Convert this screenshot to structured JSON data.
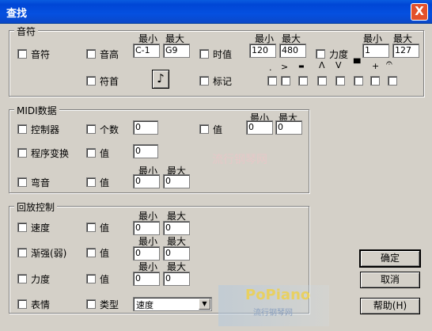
{
  "window": {
    "title": "查找",
    "close_label": "X"
  },
  "note": {
    "legend": "音符",
    "min_label": "最小",
    "max_label": "最大",
    "note_label": "音符",
    "pitch_label": "音高",
    "pitch_min": "C-1",
    "pitch_max": "G9",
    "duration_label": "时值",
    "duration_min": "120",
    "duration_max": "480",
    "velocity_label": "力度",
    "velocity_min": "1",
    "velocity_max": "127",
    "notehead_label": "符首",
    "marks_label": "标记",
    "mark_symbols": [
      ".",
      ">",
      "▬",
      "Λ",
      "V",
      "▀",
      "+",
      "𝄐"
    ]
  },
  "midi": {
    "legend": "MIDI数据",
    "min_label": "最小",
    "max_label": "最大",
    "controller_label": "控制器",
    "count_label": "个数",
    "count_value": "0",
    "value_label": "值",
    "value_min": "0",
    "value_max": "0",
    "program_label": "程序变换",
    "program_value_label": "值",
    "program_value": "0",
    "bend_label": "弯音",
    "bend_value_label": "值",
    "bend_min": "0",
    "bend_max": "0"
  },
  "playback": {
    "legend": "回放控制",
    "min_label": "最小",
    "max_label": "最大",
    "tempo_label": "速度",
    "tempo_value_label": "值",
    "tempo_min": "0",
    "tempo_max": "0",
    "dim_label": "渐强(弱)",
    "dim_value_label": "值",
    "dim_min": "0",
    "dim_max": "0",
    "dyn_label": "力度",
    "dyn_value_label": "值",
    "dyn_min": "0",
    "dyn_max": "0",
    "expr_label": "表情",
    "type_label": "类型",
    "type_value": "速度"
  },
  "buttons": {
    "ok": "确定",
    "cancel": "取消",
    "help": "帮助(H)"
  },
  "watermark": {
    "text1": "流行钢琴网",
    "logo_text": "PoPiano",
    "logo_sub": "流行钢琴网"
  }
}
